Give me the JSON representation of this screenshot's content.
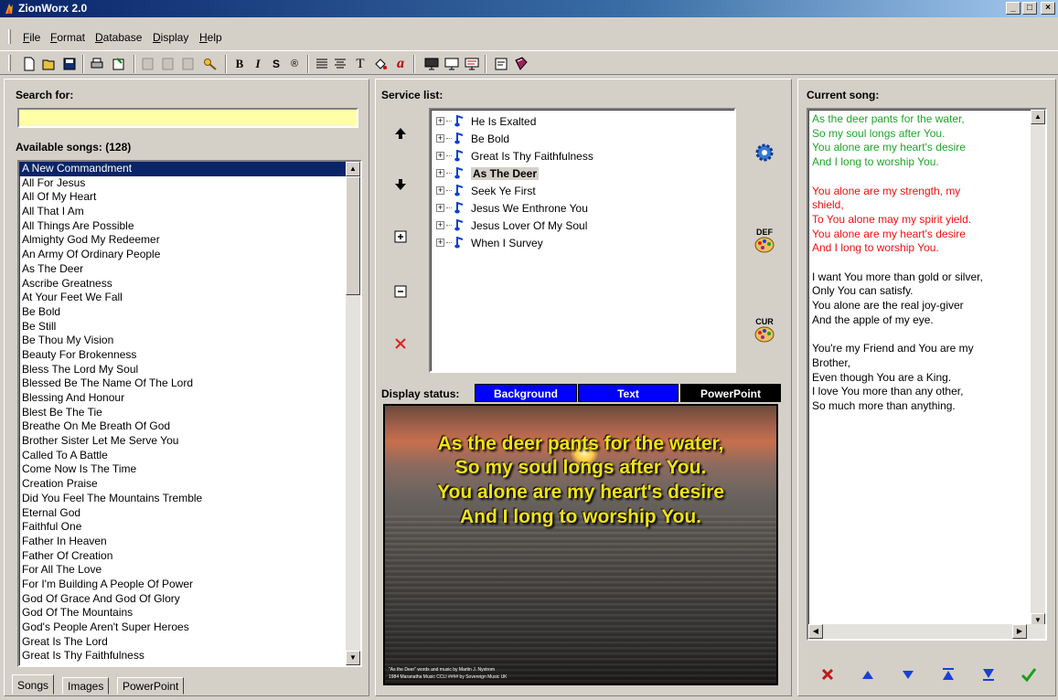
{
  "window": {
    "title": "ZionWorx 2.0",
    "minimize_glyph": "_",
    "maximize_glyph": "□",
    "close_glyph": "×"
  },
  "menu": [
    {
      "label": "File",
      "icon": ""
    },
    {
      "label": "Format",
      "icon": ""
    },
    {
      "label": "Database",
      "icon": ""
    },
    {
      "label": "Display",
      "icon": ""
    },
    {
      "label": "Help",
      "icon": ""
    }
  ],
  "toolbar": {
    "bold_label": "B",
    "italic_label": "I",
    "shadow_label": "S",
    "outline_label": "®",
    "font_label": "T",
    "font_color_label": "a"
  },
  "search": {
    "label": "Search for:",
    "value": "",
    "placeholder": ""
  },
  "available": {
    "label": "Available songs:",
    "count": "(128)",
    "songs": [
      "A New Commandment",
      "All For Jesus",
      "All Of My Heart",
      "All That I Am",
      "All Things Are Possible",
      "Almighty God My Redeemer",
      "An Army Of Ordinary People",
      "As The Deer",
      "Ascribe Greatness",
      "At Your Feet We Fall",
      "Be Bold",
      "Be Still",
      "Be Thou My Vision",
      "Beauty For Brokenness",
      "Bless The Lord My Soul",
      "Blessed Be The Name Of The Lord",
      "Blessing And Honour",
      "Blest Be The Tie",
      "Breathe On Me Breath Of God",
      "Brother Sister Let Me Serve You",
      "Called To A Battle",
      "Come Now Is The Time",
      "Creation Praise",
      "Did You Feel The Mountains Tremble",
      "Eternal God",
      "Faithful One",
      "Father In Heaven",
      "Father Of Creation",
      "For All The Love",
      "For I'm Building A People Of Power",
      "God Of Grace And God Of Glory",
      "God Of The Mountains",
      "God's People Aren't Super Heroes",
      "Great Is The Lord",
      "Great Is Thy Faithfulness"
    ]
  },
  "tabs": [
    "Songs",
    "Images",
    "PowerPoint"
  ],
  "service": {
    "label": "Service list:",
    "items": [
      "He Is Exalted",
      "Be Bold",
      "Great Is Thy Faithfulness",
      "As The Deer",
      "Seek Ye First",
      "Jesus We Enthrone You",
      "Jesus Lover Of My Soul",
      "When I Survey"
    ],
    "selected_index": 3,
    "def_label": "DEF",
    "cur_label": "CUR"
  },
  "display_status": {
    "label": "Display status:",
    "background": "Background",
    "text": "Text",
    "powerpoint": "PowerPoint",
    "colors": {
      "background_badge": "#0000ff",
      "text_badge": "#0000ff",
      "powerpoint_badge": "#000000"
    }
  },
  "preview": {
    "lines": [
      "As the deer pants for the water,",
      "So my soul longs after You.",
      "You alone are my heart's desire",
      "And I long to worship You."
    ],
    "credit_1": "\"As the Deer\" words and music by Martin J. Nystrom",
    "credit_2": "1984 Maranatha Music CCLI #### by Sovereign Music UK",
    "text_color": "#f0e21a"
  },
  "current_song": {
    "label": "Current song:",
    "lines": [
      {
        "text": "As the deer pants for the water,",
        "color": "green"
      },
      {
        "text": "So my soul longs after You.",
        "color": "green"
      },
      {
        "text": "You alone are my heart's desire",
        "color": "green"
      },
      {
        "text": "And I long to worship You.",
        "color": "green"
      },
      {
        "text": "",
        "color": "black"
      },
      {
        "text": "You alone are my strength, my",
        "color": "red"
      },
      {
        "text": "shield,",
        "color": "red"
      },
      {
        "text": "To You alone may my spirit yield.",
        "color": "red"
      },
      {
        "text": "You alone are my heart's desire",
        "color": "red"
      },
      {
        "text": "And I long to worship You.",
        "color": "red"
      },
      {
        "text": "",
        "color": "black"
      },
      {
        "text": "I want You more than gold or silver,",
        "color": "black"
      },
      {
        "text": "Only You can satisfy.",
        "color": "black"
      },
      {
        "text": "You alone are the real joy-giver",
        "color": "black"
      },
      {
        "text": "And the apple of my eye.",
        "color": "black"
      },
      {
        "text": "",
        "color": "black"
      },
      {
        "text": "You're my Friend and You are my",
        "color": "black"
      },
      {
        "text": "Brother,",
        "color": "black"
      },
      {
        "text": "Even though You are a King.",
        "color": "black"
      },
      {
        "text": "I love You more than any other,",
        "color": "black"
      },
      {
        "text": "So much more than anything.",
        "color": "black"
      }
    ]
  },
  "colors": {
    "green": "#1fa52a",
    "red": "#ee1111",
    "selection": "#0a246a",
    "search_bg": "#ffffa8"
  }
}
